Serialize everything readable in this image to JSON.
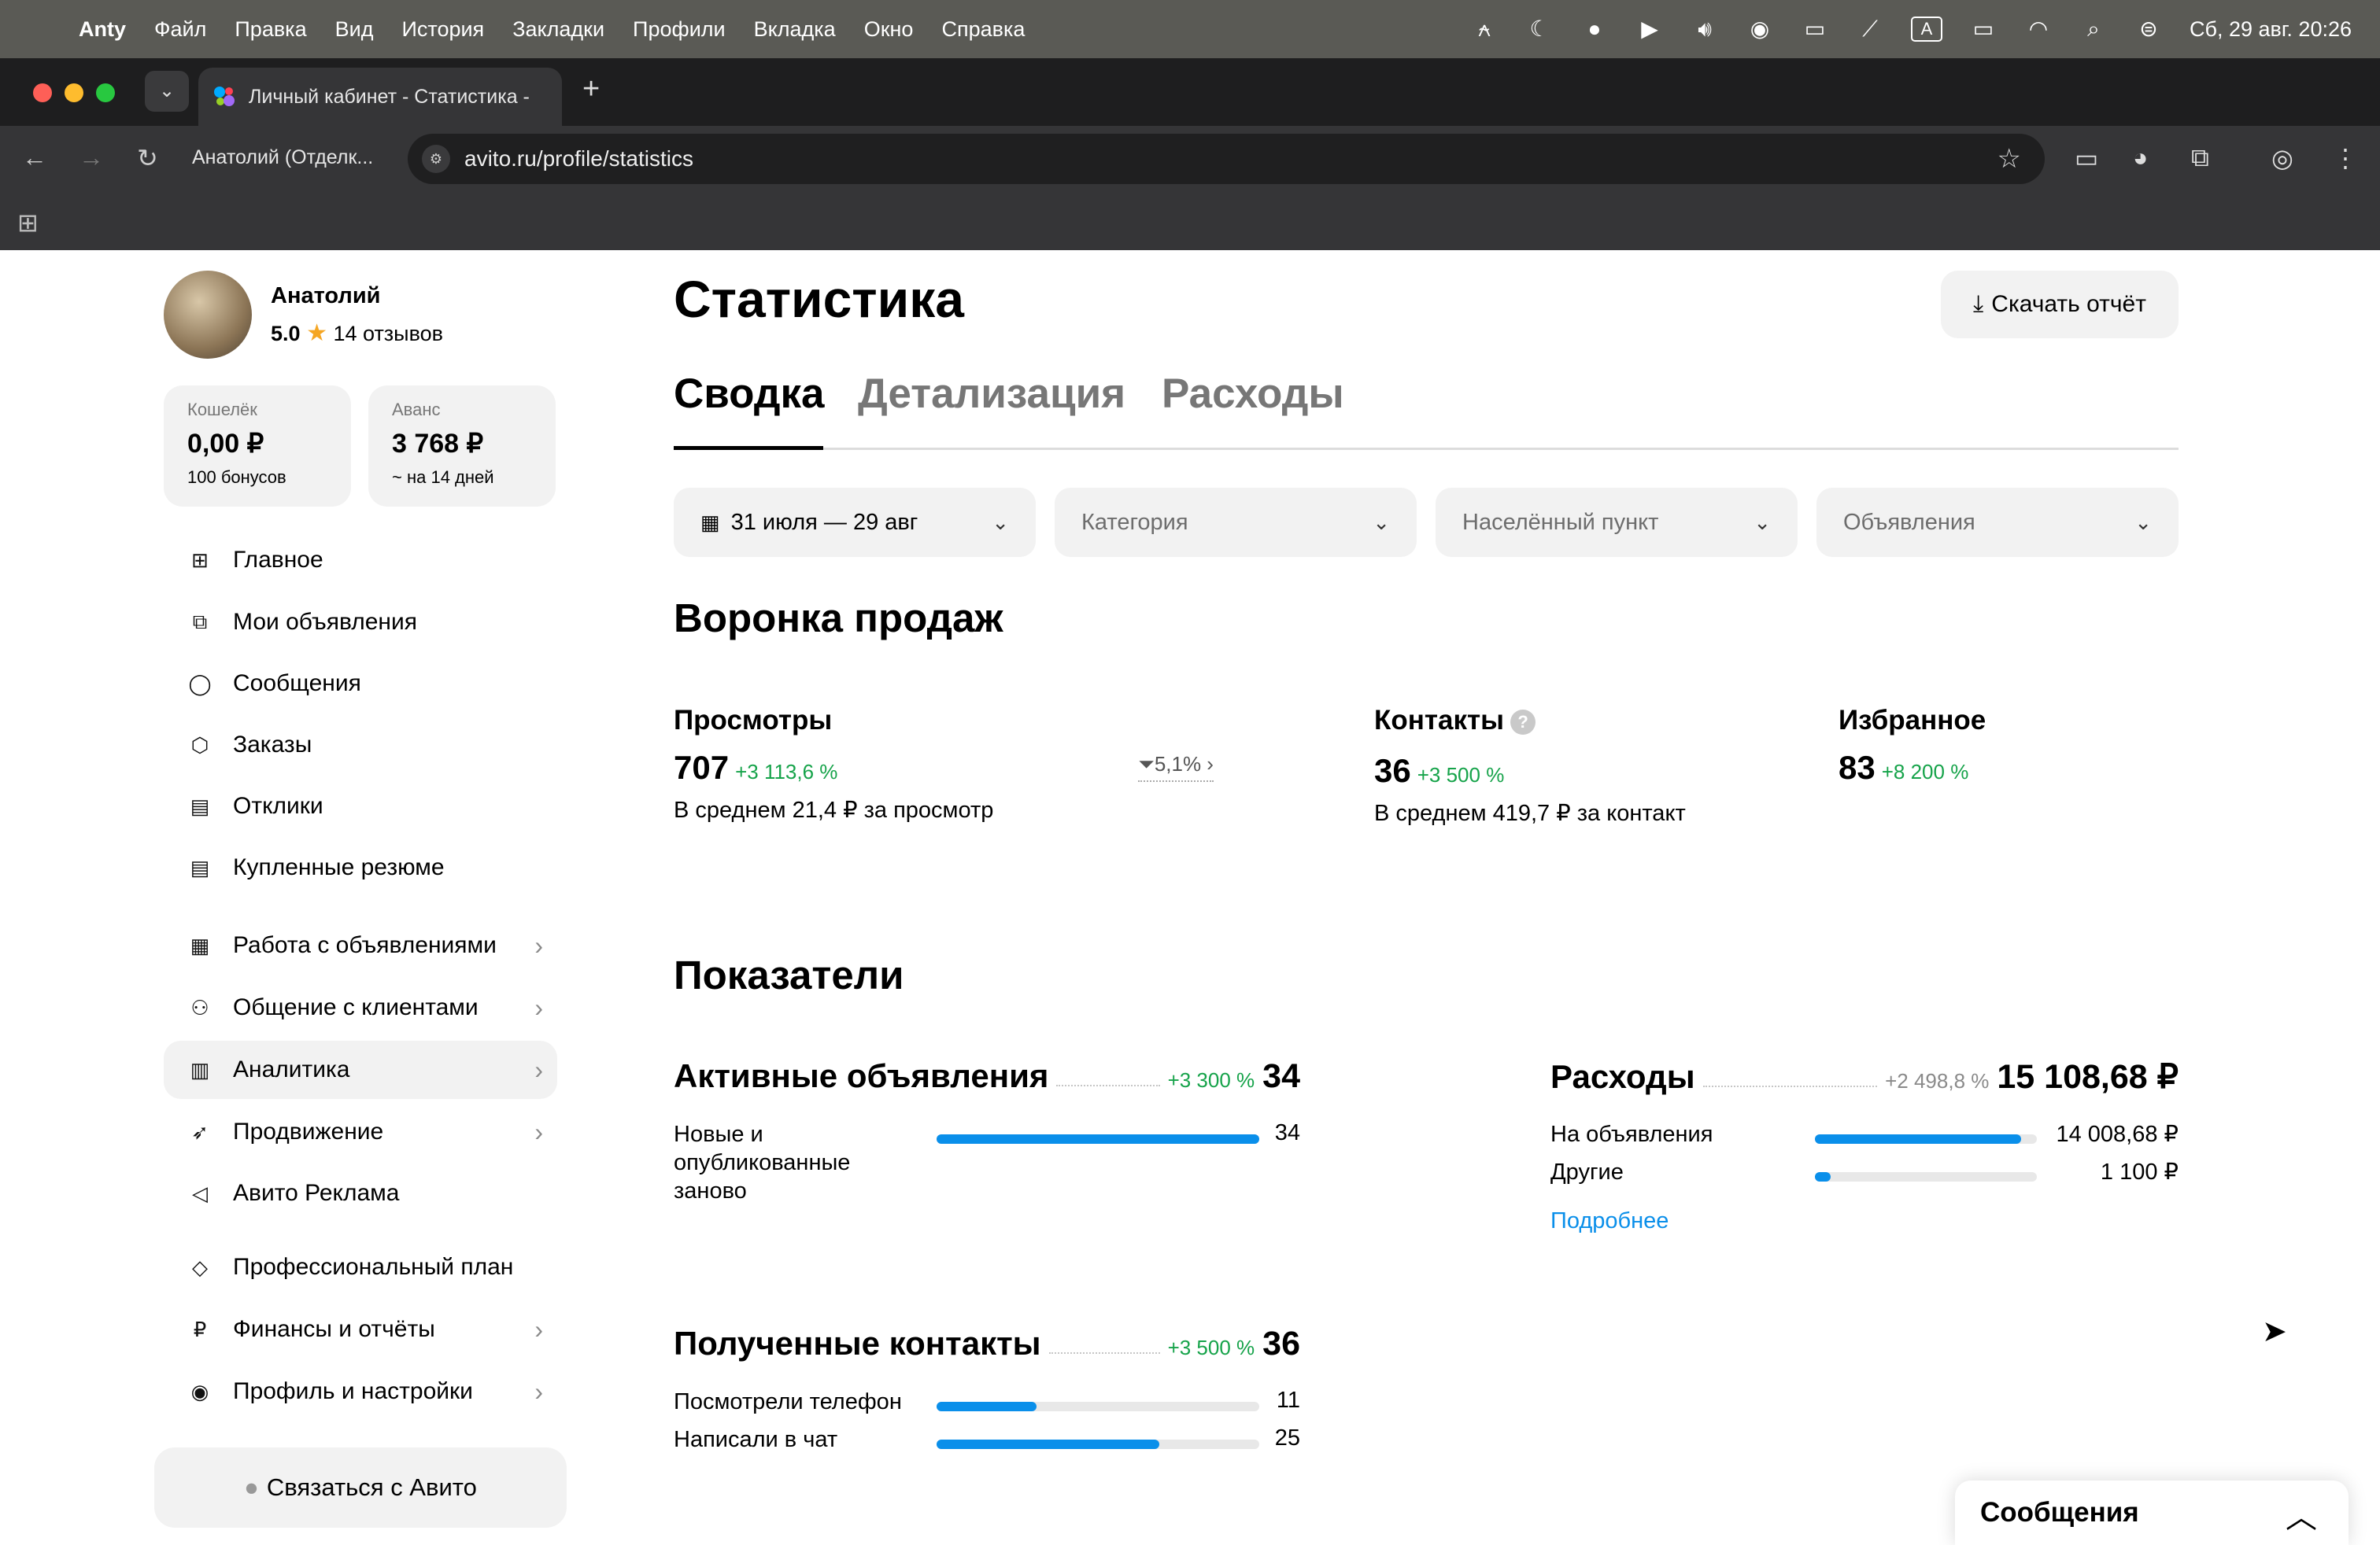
{
  "menubar": {
    "app": "Anty",
    "items": [
      "Файл",
      "Правка",
      "Вид",
      "История",
      "Закладки",
      "Профили",
      "Вкладка",
      "Окно",
      "Справка"
    ],
    "datetime": "Сб, 29 авг.  20:26",
    "input_indicator": "A"
  },
  "browser": {
    "tab_title": "Личный кабинет - Статистика -",
    "profile_label": "Анатолий (Отделк...",
    "url": "avito.ru/profile/statistics"
  },
  "user": {
    "name": "Анатолий",
    "rating": "5.0",
    "reviews": "14 отзывов"
  },
  "wallet": {
    "label": "Кошелёк",
    "value": "0,00 ₽",
    "sub": "100 бонусов"
  },
  "advance": {
    "label": "Аванс",
    "value": "3 768 ₽",
    "sub": "~ на 14 дней"
  },
  "nav": [
    {
      "label": "Главное",
      "icon": "grid-icon"
    },
    {
      "label": "Мои объявления",
      "icon": "copy-icon"
    },
    {
      "label": "Сообщения",
      "icon": "chat-icon"
    },
    {
      "label": "Заказы",
      "icon": "box-icon"
    },
    {
      "label": "Отклики",
      "icon": "document-icon"
    },
    {
      "label": "Купленные резюме",
      "icon": "resume-icon"
    },
    {
      "label": "Работа с объявлениями",
      "icon": "layout-icon"
    },
    {
      "label": "Общение с клиентами",
      "icon": "users-icon"
    },
    {
      "label": "Аналитика",
      "icon": "bar-chart-icon"
    },
    {
      "label": "Продвижение",
      "icon": "rocket-icon"
    },
    {
      "label": "Авито Реклама",
      "icon": "megaphone-icon"
    },
    {
      "label": "Профессиональный план",
      "icon": "diamond-icon"
    },
    {
      "label": "Финансы и отчёты",
      "icon": "ruble-icon"
    },
    {
      "label": "Профиль и настройки",
      "icon": "user-circle-icon"
    }
  ],
  "contact_avito": "Связаться с Авито",
  "page_title": "Статистика",
  "download_report": "Скачать отчёт",
  "tabs": [
    "Сводка",
    "Детализация",
    "Расходы"
  ],
  "filters": {
    "date": "31 июля — 29 авг",
    "category": "Категория",
    "city": "Населённый пункт",
    "ads": "Объявления"
  },
  "funnel": {
    "title": "Воронка продаж",
    "views": {
      "label": "Просмотры",
      "value": "707",
      "delta": "+3 113,6 %",
      "sub": "В среднем 21,4 ₽ за просмотр"
    },
    "conversion": "5,1%",
    "contacts": {
      "label": "Контакты",
      "value": "36",
      "delta": "+3 500 %",
      "sub": "В среднем 419,7 ₽ за контакт"
    },
    "favorites": {
      "label": "Избранное",
      "value": "83",
      "delta": "+8 200 %"
    }
  },
  "indicators": {
    "title": "Показатели",
    "active_ads": {
      "title": "Активные объявления",
      "delta": "+3 300 %",
      "total": "34",
      "rows": [
        {
          "label": "Новые и опубликованные заново",
          "value": "34",
          "fraction": 1.0
        }
      ]
    },
    "expenses": {
      "title": "Расходы",
      "delta": "+2 498,8 %",
      "total": "15 108,68 ₽",
      "rows": [
        {
          "label": "На объявления",
          "value": "14 008,68 ₽",
          "fraction": 0.93
        },
        {
          "label": "Другие",
          "value": "1 100 ₽",
          "fraction": 0.07
        }
      ],
      "more": "Подробнее"
    },
    "contacts": {
      "title": "Полученные контакты",
      "delta": "+3 500 %",
      "total": "36",
      "rows": [
        {
          "label": "Посмотрели телефон",
          "value": "11",
          "fraction": 0.31
        },
        {
          "label": "Написали в чат",
          "value": "25",
          "fraction": 0.69
        }
      ]
    }
  },
  "messages_widget": "Сообщения",
  "colors": {
    "accent": "#0a8fea",
    "positive": "#16a34a",
    "surface": "#f2f2f2"
  }
}
